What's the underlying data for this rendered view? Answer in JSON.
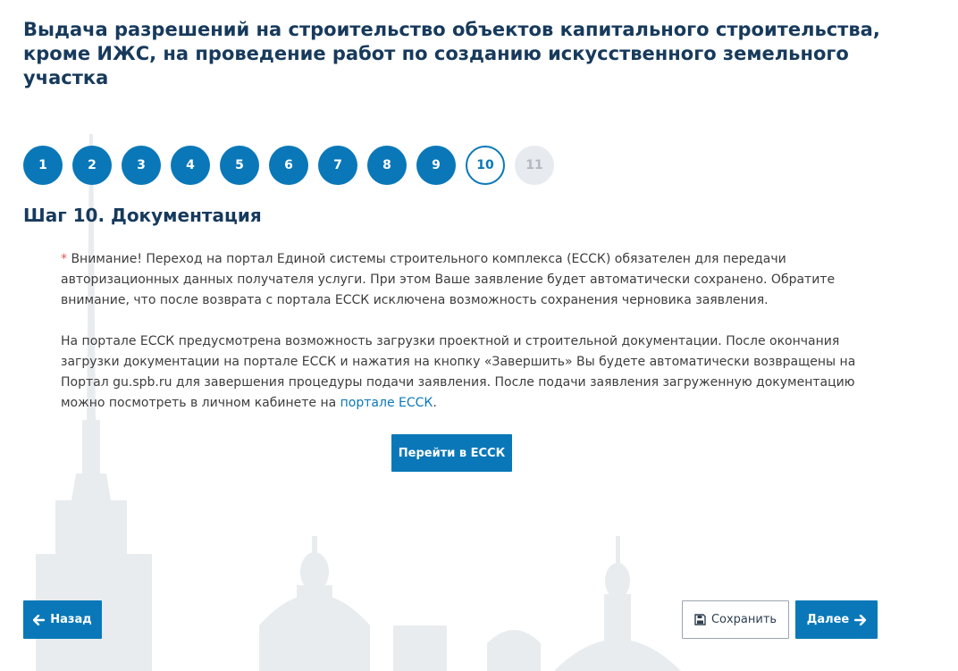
{
  "page": {
    "title": "Выдача разрешений на строительство объектов капитального строительства, кроме ИЖС, на проведение работ по созданию искусственного земельного участка",
    "step_heading": "Шаг 10. Документация"
  },
  "stepper": {
    "current": 10,
    "steps": [
      {
        "label": "1",
        "state": "done"
      },
      {
        "label": "2",
        "state": "done"
      },
      {
        "label": "3",
        "state": "done"
      },
      {
        "label": "4",
        "state": "done"
      },
      {
        "label": "5",
        "state": "done"
      },
      {
        "label": "6",
        "state": "done"
      },
      {
        "label": "7",
        "state": "done"
      },
      {
        "label": "8",
        "state": "done"
      },
      {
        "label": "9",
        "state": "done"
      },
      {
        "label": "10",
        "state": "current"
      },
      {
        "label": "11",
        "state": "future"
      }
    ]
  },
  "notice": {
    "asterisk": "*",
    "paragraph1": " Внимание! Переход на портал Единой системы строительного комплекса (ЕССК) обязателен для передачи авторизационных данных получателя услуги. При этом Ваше заявление будет автоматически сохранено. Обратите внимание, что после возврата с портала ЕССК исключена возможность сохранения черновика заявления.",
    "paragraph2_text": "На портале ЕССК предусмотрена возможность загрузки проектной и строительной документации. После окончания загрузки документации на портале ЕССК и нажатия на кнопку «Завершить» Вы будете автоматически возвращены на Портал gu.spb.ru для завершения процедуры подачи заявления. После подачи заявления загруженную документацию можно посмотреть в личном кабинете на ",
    "paragraph2_link": "портале ЕССК",
    "paragraph2_end": "."
  },
  "buttons": {
    "go_essk": "Перейти в ЕССК",
    "back": "Назад",
    "save": "Сохранить",
    "next": "Далее"
  },
  "icons": {
    "back": "arrow-left-icon",
    "save": "floppy-disk-icon",
    "next": "arrow-right-icon"
  },
  "colors": {
    "primary": "#0a78b8",
    "title": "#173a5c",
    "asterisk": "#e2574c",
    "step_future_bg": "#e7eaee",
    "skyline": "#e8ecef"
  }
}
